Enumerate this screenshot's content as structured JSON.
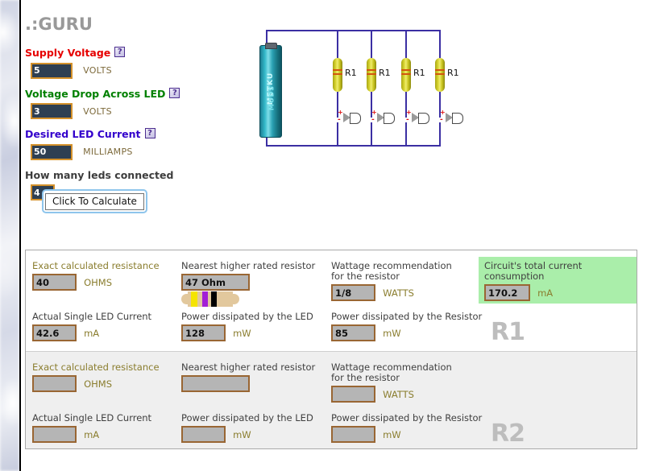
{
  "site": {
    "logo_text": ".:GURU"
  },
  "form": {
    "fields": [
      {
        "label": "Supply Voltage",
        "value": "5",
        "unit": "VOLTS",
        "help": "?",
        "color": "#e60000"
      },
      {
        "label": "Voltage Drop Across LED",
        "value": "3",
        "unit": "VOLTS",
        "help": "?",
        "color": "#008000"
      },
      {
        "label": "Desired LED Current",
        "value": "50",
        "unit": "MILLIAMPS",
        "help": "?",
        "color": "#3300cc"
      },
      {
        "label": "How many leds connected",
        "value": "4",
        "unit": "",
        "help": "",
        "color": "#3d3d3d"
      }
    ],
    "calculate_label": "Click To Calculate"
  },
  "circuit": {
    "battery_brand_line1": "METKU",
    "battery_brand_line2": "MODS",
    "resistor_labels": [
      "R1",
      "R1",
      "R1",
      "R1"
    ],
    "led_plus": "+",
    "led_minus": "-",
    "branch_count": 4,
    "wire_color": "#3b2fa3"
  },
  "results": {
    "accent_green": "#aaeeaa",
    "rows": [
      {
        "name": "R1",
        "big_label": "R1",
        "highlighted": false,
        "exact_resistance_label": "Exact calculated resistance",
        "exact_resistance_value": "40",
        "exact_resistance_unit": "OHMS",
        "nearest_resistor_label": "Nearest higher rated resistor",
        "nearest_resistor_value": "47 Ohm",
        "band_colors": [
          "#f5e400",
          "#a21fd6",
          "#000000"
        ],
        "wattage_label": "Wattage recommendation for the resistor",
        "wattage_value": "1/8",
        "wattage_unit": "WATTS",
        "total_current_label": "Circuit's total current consumption",
        "total_current_value": "170.2",
        "total_current_unit": "mA",
        "led_current_label": "Actual Single LED Current",
        "led_current_value": "42.6",
        "led_current_unit": "mA",
        "led_power_label": "Power dissipated by the LED",
        "led_power_value": "128",
        "led_power_unit": "mW",
        "res_power_label": "Power dissipated by the Resistor",
        "res_power_value": "85",
        "res_power_unit": "mW"
      },
      {
        "name": "R2",
        "big_label": "R2",
        "highlighted": true,
        "exact_resistance_label": "Exact calculated resistance",
        "exact_resistance_value": "",
        "exact_resistance_unit": "OHMS",
        "nearest_resistor_label": "Nearest higher rated resistor",
        "nearest_resistor_value": "",
        "band_colors": [],
        "wattage_label": "Wattage recommendation for the resistor",
        "wattage_value": "",
        "wattage_unit": "WATTS",
        "total_current_label": "",
        "total_current_value": "",
        "total_current_unit": "",
        "led_current_label": "Actual Single LED Current",
        "led_current_value": "",
        "led_current_unit": "mA",
        "led_power_label": "Power dissipated by the LED",
        "led_power_value": "",
        "led_power_unit": "mW",
        "res_power_label": "Power dissipated by the Resistor",
        "res_power_value": "",
        "res_power_unit": "mW"
      }
    ]
  }
}
